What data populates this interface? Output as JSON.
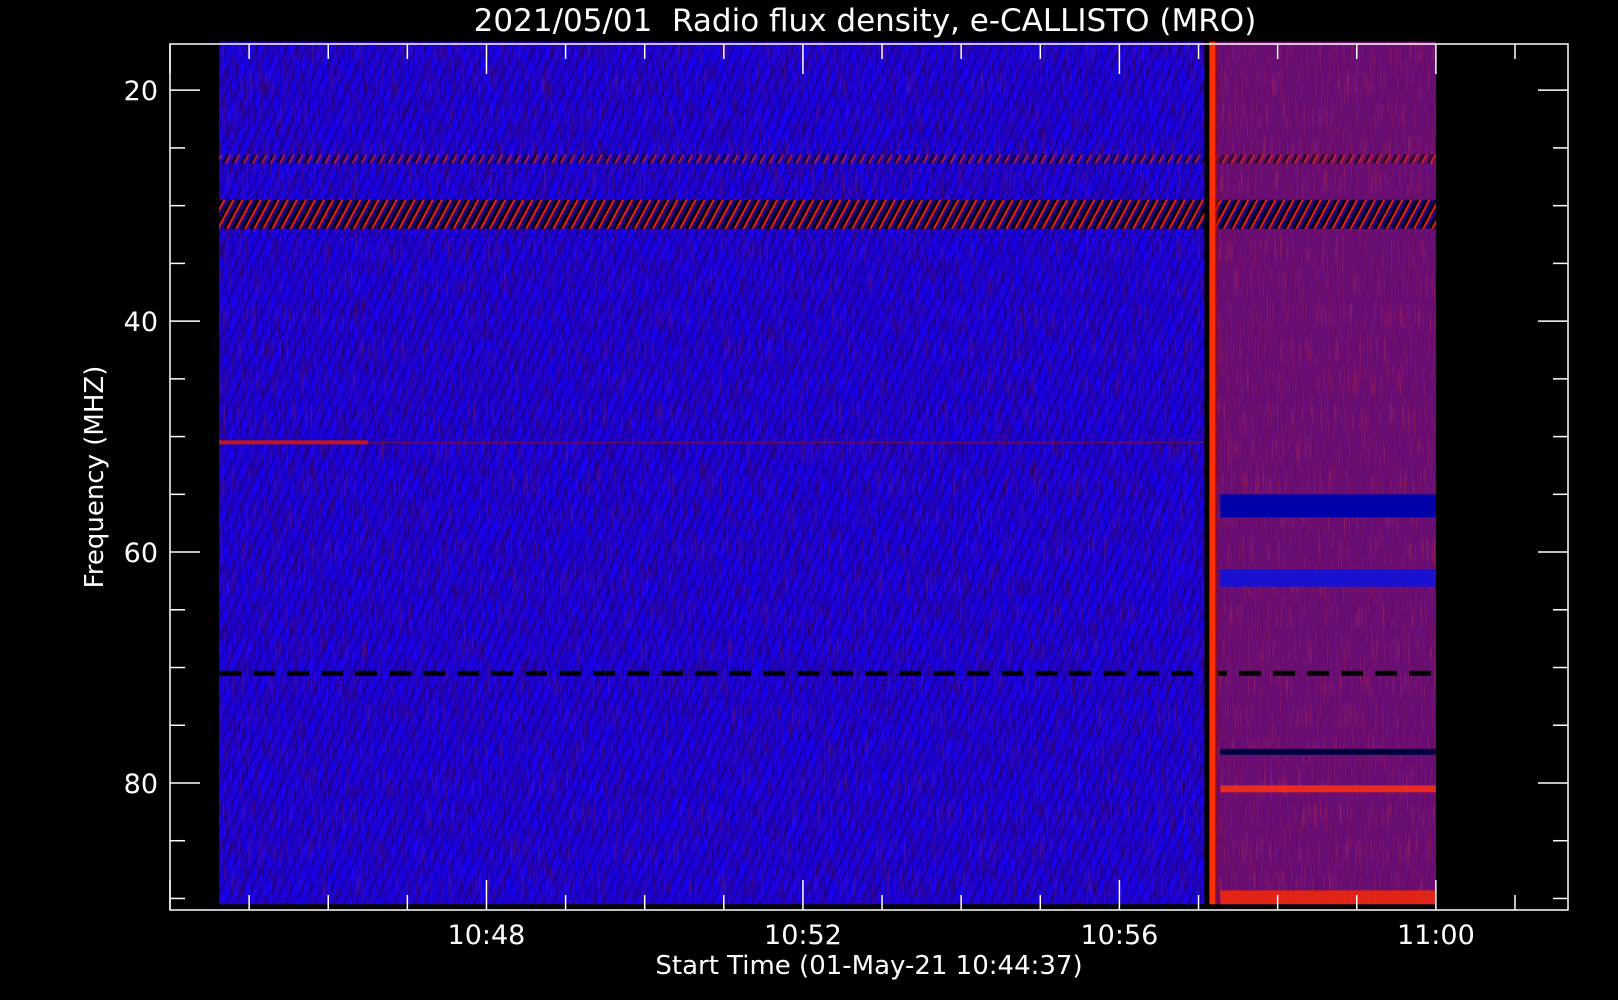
{
  "chart_data": {
    "type": "heatmap",
    "title": "2021/05/01  Radio flux density, e-CALLISTO (MRO)",
    "xlabel": "Start Time (01-May-21 10:44:37)",
    "ylabel": "Frequency (MHZ)",
    "x_ticks": [
      {
        "minutes": 48,
        "label": "10:48"
      },
      {
        "minutes": 52,
        "label": "10:52"
      },
      {
        "minutes": 56,
        "label": "10:56"
      },
      {
        "minutes": 60,
        "label": "11:00"
      }
    ],
    "y_ticks": [
      {
        "value": 20,
        "label": "20"
      },
      {
        "value": 40,
        "label": "40"
      },
      {
        "value": 60,
        "label": "60"
      },
      {
        "value": 80,
        "label": "80"
      }
    ],
    "x_minor_step_minutes": 1,
    "y_minor_step_mhz": 5,
    "xlim_minutes": [
      44.0,
      61.67
    ],
    "ylim_mhz": [
      16.0,
      91.0
    ],
    "data_extent": {
      "t_start_minutes": 44.62,
      "t_end_minutes": 60.0,
      "f_min_mhz": 15.8,
      "f_max_mhz": 90.5
    },
    "y_inverted": true,
    "colormap": [
      "#000000",
      "#1a00ff",
      "#ff2a00",
      "#ffe000"
    ],
    "background_color": "#1400f5",
    "features": {
      "burst_time_minutes": 57.15,
      "post_burst_level": "elevated",
      "interference_band_mhz": [
        29.5,
        32.0
      ],
      "secondary_band_mhz": 26.0,
      "horizontal_line_mhz": 50.5,
      "dashed_line_mhz": 70.5,
      "dark_band_post_burst_mhz": [
        55.0,
        57.0
      ],
      "post_burst_dark_line_mhz": 77.3
    }
  }
}
